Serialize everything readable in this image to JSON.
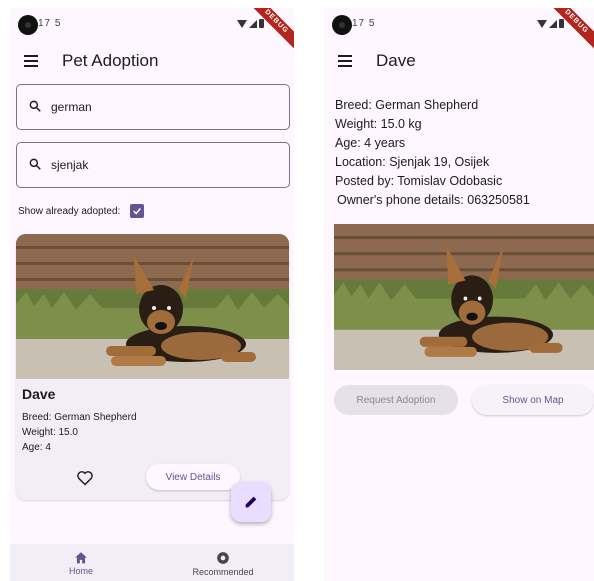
{
  "left": {
    "status": {
      "time": "17",
      "extra": "5",
      "ribbon": "DEBUG"
    },
    "appbar": {
      "title": "Pet Adoption",
      "menu_icon": "menu-icon"
    },
    "search1": {
      "value": "german",
      "icon": "search-icon"
    },
    "search2": {
      "value": "sjenjak",
      "icon": "search-icon"
    },
    "show_adopted": {
      "label": "Show already adopted:",
      "checked": true
    },
    "card": {
      "name": "Dave",
      "breed": "Breed: German Shepherd",
      "weight": "Weight: 15.0",
      "age": "Age: 4",
      "favorite_icon": "heart-outline-icon",
      "details_button": "View Details"
    },
    "fab_icon": "edit-pencil-icon",
    "nav": [
      {
        "label": "Home",
        "icon": "home-icon",
        "active": true
      },
      {
        "label": "Recommended",
        "icon": "recommended-icon",
        "active": false
      }
    ]
  },
  "right": {
    "status": {
      "time": "17",
      "extra": "5",
      "ribbon": "DEBUG"
    },
    "appbar": {
      "title": "Dave",
      "menu_icon": "menu-icon"
    },
    "details": {
      "breed": "Breed: German Shepherd",
      "weight": "Weight: 15.0 kg",
      "age": "Age: 4 years",
      "location": "Location: Sjenjak 19, Osijek",
      "posted_by": "Posted by: Tomislav Odobasic",
      "phone": "Owner's phone details: 063250581"
    },
    "buttons": {
      "request": "Request Adoption",
      "map": "Show on Map"
    }
  },
  "colors": {
    "primary": "#65558f",
    "surface": "#fef7ff",
    "card": "#f3edf7",
    "fab": "#eaddff"
  }
}
